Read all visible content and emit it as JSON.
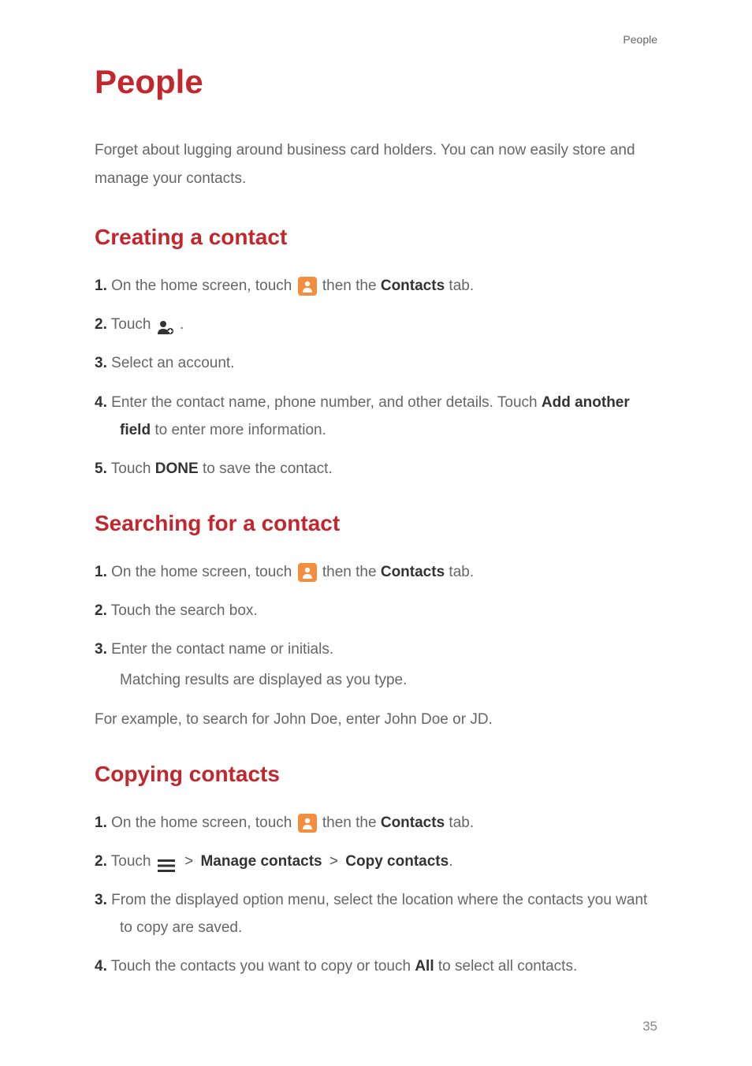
{
  "header_label": "People",
  "title": "People",
  "intro": "Forget about lugging around business card holders. You can now easily store and manage your contacts.",
  "sections": {
    "creating": {
      "heading": "Creating a contact",
      "s1a": "On the home screen, touch ",
      "s1b": " then the ",
      "s1c": "Contacts",
      "s1d": " tab.",
      "s2a": "Touch ",
      "s2b": " .",
      "s3": "Select an account.",
      "s4a": "Enter the contact name, phone number, and other details. Touch ",
      "s4b": "Add another field",
      "s4c": " to enter more information.",
      "s5a": "Touch ",
      "s5b": "DONE",
      "s5c": " to save the contact."
    },
    "searching": {
      "heading": "Searching for a contact",
      "s1a": "On the home screen, touch ",
      "s1b": " then the ",
      "s1c": "Contacts",
      "s1d": " tab.",
      "s2": "Touch the search box.",
      "s3": "Enter the contact name or initials.",
      "s3sub": "Matching results are displayed as you type.",
      "exa": "For example, to search for John Doe, enter ",
      "exb": "John Doe",
      "exc": " or ",
      "exd": "JD",
      "exe": "."
    },
    "copying": {
      "heading": "Copying contacts",
      "s1a": "On the home screen, touch ",
      "s1b": " then the ",
      "s1c": "Contacts",
      "s1d": " tab.",
      "s2a": "Touch ",
      "s2b": "Manage contacts",
      "s2c": "Copy contacts",
      "s3": "From the displayed option menu, select the location where the contacts you want to copy are saved.",
      "s4a": "Touch the contacts you want to copy or touch ",
      "s4b": "All",
      "s4c": " to select all contacts."
    }
  },
  "nums": {
    "1": "1.",
    "2": "2.",
    "3": "3.",
    "4": "4.",
    "5": "5."
  },
  "gt": ">",
  "page_number": "35"
}
